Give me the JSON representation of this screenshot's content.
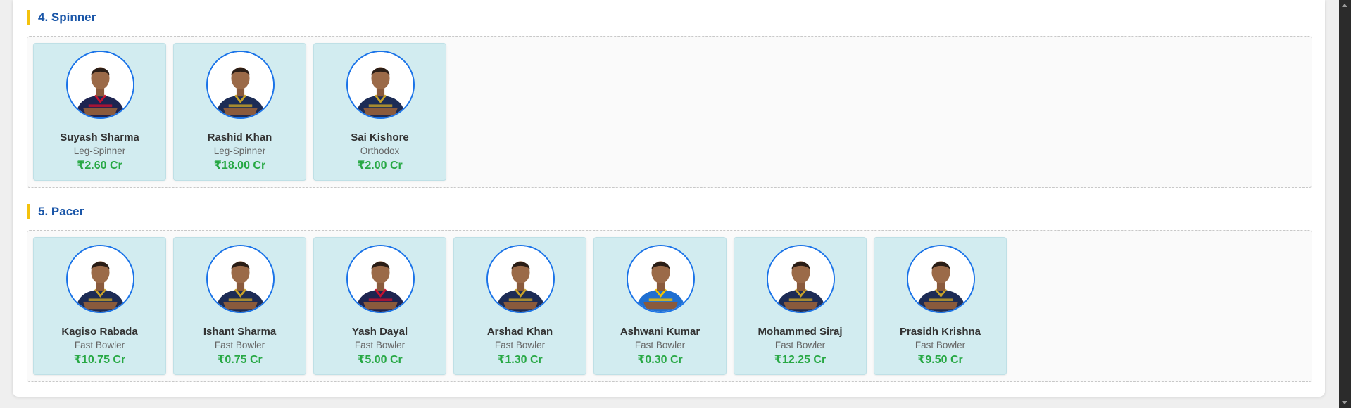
{
  "sections": [
    {
      "title": "4. Spinner",
      "players": [
        {
          "name": "Suyash Sharma",
          "role": "Leg-Spinner",
          "price": "₹2.60 Cr",
          "jersey": "#1e2450",
          "accent": "#c8102e"
        },
        {
          "name": "Rashid Khan",
          "role": "Leg-Spinner",
          "price": "₹18.00 Cr",
          "jersey": "#1d2c55",
          "accent": "#c9a227"
        },
        {
          "name": "Sai Kishore",
          "role": "Orthodox",
          "price": "₹2.00 Cr",
          "jersey": "#1d2c55",
          "accent": "#c9a227"
        }
      ]
    },
    {
      "title": "5. Pacer",
      "players": [
        {
          "name": "Kagiso Rabada",
          "role": "Fast Bowler",
          "price": "₹10.75 Cr",
          "jersey": "#1d2c55",
          "accent": "#c9a227"
        },
        {
          "name": "Ishant Sharma",
          "role": "Fast Bowler",
          "price": "₹0.75 Cr",
          "jersey": "#1d2c55",
          "accent": "#c9a227"
        },
        {
          "name": "Yash Dayal",
          "role": "Fast Bowler",
          "price": "₹5.00 Cr",
          "jersey": "#1e2450",
          "accent": "#c8102e"
        },
        {
          "name": "Arshad Khan",
          "role": "Fast Bowler",
          "price": "₹1.30 Cr",
          "jersey": "#1d2c55",
          "accent": "#c9a227"
        },
        {
          "name": "Ashwani Kumar",
          "role": "Fast Bowler",
          "price": "₹0.30 Cr",
          "jersey": "#1f6fd1",
          "accent": "#f2c200"
        },
        {
          "name": "Mohammed Siraj",
          "role": "Fast Bowler",
          "price": "₹12.25 Cr",
          "jersey": "#1d2c55",
          "accent": "#c9a227"
        },
        {
          "name": "Prasidh Krishna",
          "role": "Fast Bowler",
          "price": "₹9.50 Cr",
          "jersey": "#1d2c55",
          "accent": "#c9a227"
        }
      ]
    }
  ],
  "colors": {
    "title_accent": "#f4c20d",
    "title_text": "#1a56a8",
    "card_bg": "#d2ecf0",
    "avatar_border": "#1a73e8",
    "price": "#27a844"
  }
}
